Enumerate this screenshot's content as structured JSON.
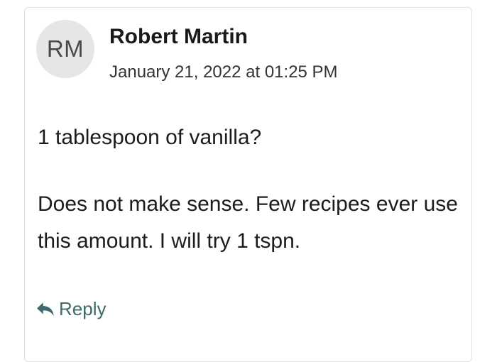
{
  "comment": {
    "avatar_initials": "RM",
    "author": "Robert Martin",
    "timestamp": "January 21, 2022 at 01:25 PM",
    "paragraphs": [
      "1 tablespoon of vanilla?",
      "Does not make sense. Few recipes ever use this amount. I will try 1 tspn."
    ],
    "reply_label": "Reply",
    "reply_icon": "reply-arrow-icon"
  },
  "colors": {
    "reply_accent": "#3f6a6b",
    "avatar_background": "#e6e6e6"
  }
}
